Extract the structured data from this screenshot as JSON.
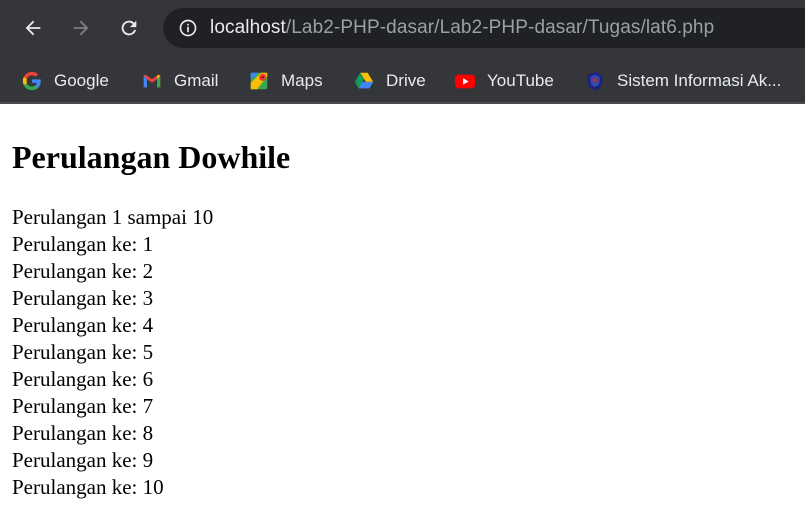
{
  "browser": {
    "url_host": "localhost",
    "url_path": "/Lab2-PHP-dasar/Lab2-PHP-dasar/Tugas/lat6.php",
    "bookmarks": [
      {
        "label": "Google",
        "icon": "google-icon"
      },
      {
        "label": "Gmail",
        "icon": "gmail-icon"
      },
      {
        "label": "Maps",
        "icon": "maps-icon"
      },
      {
        "label": "Drive",
        "icon": "drive-icon"
      },
      {
        "label": "YouTube",
        "icon": "youtube-icon"
      },
      {
        "label": "Sistem Informasi Ak...",
        "icon": "university-crest-icon"
      }
    ]
  },
  "page": {
    "heading": "Perulangan Dowhile",
    "lines": [
      "Perulangan 1 sampai 10",
      "Perulangan ke: 1",
      "Perulangan ke: 2",
      "Perulangan ke: 3",
      "Perulangan ke: 4",
      "Perulangan ke: 5",
      "Perulangan ke: 6",
      "Perulangan ke: 7",
      "Perulangan ke: 8",
      "Perulangan ke: 9",
      "Perulangan ke: 10"
    ]
  },
  "colors": {
    "chrome_bg": "#35363a",
    "omnibox_bg": "#202124",
    "page_bg": "#ffffff"
  }
}
